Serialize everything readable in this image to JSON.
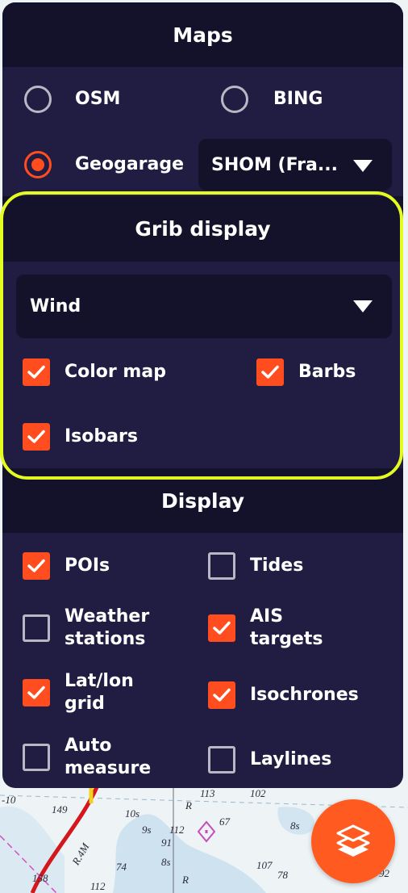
{
  "maps": {
    "header": "Maps",
    "options": [
      {
        "label": "OSM",
        "selected": false
      },
      {
        "label": "BING",
        "selected": false
      },
      {
        "label": "Geogarage",
        "selected": true
      }
    ],
    "geogarage_source": "SHOM (Fra..."
  },
  "grib": {
    "header": "Grib display",
    "parameter": "Wind",
    "options": [
      {
        "label": "Color map",
        "checked": true
      },
      {
        "label": "Barbs",
        "checked": true
      },
      {
        "label": "Isobars",
        "checked": true
      }
    ]
  },
  "display": {
    "header": "Display",
    "options": [
      {
        "label": [
          "POIs"
        ],
        "checked": true
      },
      {
        "label": [
          "Tides"
        ],
        "checked": false
      },
      {
        "label": [
          "Weather",
          "stations"
        ],
        "checked": false
      },
      {
        "label": [
          "AIS",
          "targets"
        ],
        "checked": true
      },
      {
        "label": [
          "Lat/lon",
          "grid"
        ],
        "checked": true
      },
      {
        "label": [
          "Isochrones"
        ],
        "checked": true
      },
      {
        "label": [
          "Auto",
          "measure"
        ],
        "checked": false
      },
      {
        "label": [
          "Laylines"
        ],
        "checked": false
      }
    ]
  },
  "chart_labels": [
    "-10",
    "149",
    "10s",
    "113",
    "R",
    "102",
    "67",
    "8s",
    "112",
    "9s",
    "R.4M",
    "91",
    "74",
    "8s",
    "107",
    "78",
    "158",
    "112",
    "R",
    "92"
  ],
  "layers_button": {
    "icon": "layers-icon"
  },
  "colors": {
    "panel": "#211c42",
    "header": "#14122a",
    "accent": "#ff4d1f",
    "highlight": "#e4fc1f"
  }
}
